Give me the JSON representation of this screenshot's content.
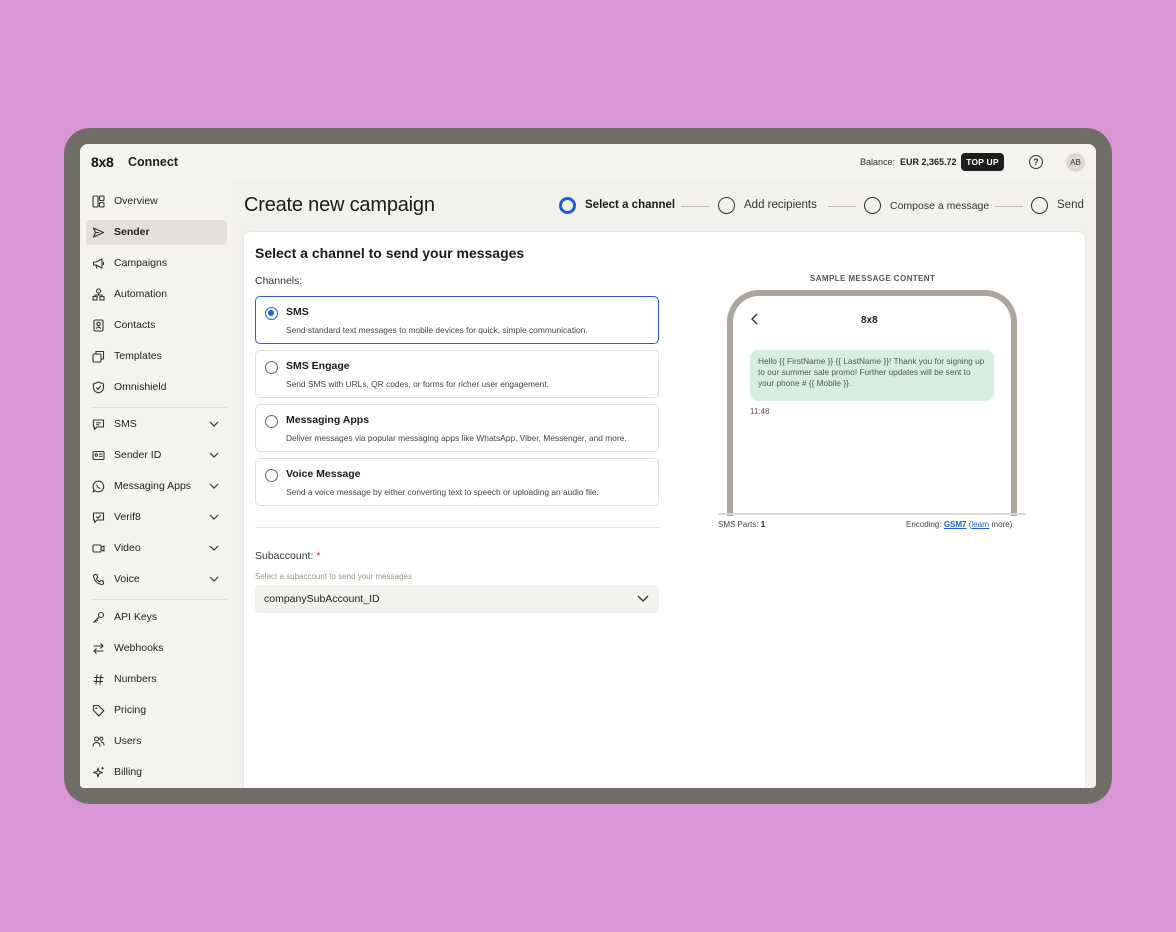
{
  "app": {
    "logo": "8x8",
    "name": "Connect",
    "balance_label": "Balance:",
    "balance_value": "EUR 2,365.72",
    "topup_label": "TOP UP",
    "help_icon": "?",
    "avatar_initials": "AB"
  },
  "sidebar": {
    "items": [
      {
        "label": "Overview",
        "icon": "overview-icon"
      },
      {
        "label": "Sender",
        "icon": "send-icon"
      },
      {
        "label": "Campaigns",
        "icon": "megaphone-icon"
      },
      {
        "label": "Automation",
        "icon": "automation-icon"
      },
      {
        "label": "Contacts",
        "icon": "contacts-icon"
      },
      {
        "label": "Templates",
        "icon": "templates-icon"
      },
      {
        "label": "Omnishield",
        "icon": "shield-icon"
      },
      {
        "label": "SMS",
        "icon": "sms-icon"
      },
      {
        "label": "Sender ID",
        "icon": "id-card-icon"
      },
      {
        "label": "Messaging Apps",
        "icon": "whatsapp-icon"
      },
      {
        "label": "Verif8",
        "icon": "verify-icon"
      },
      {
        "label": "Video",
        "icon": "video-icon"
      },
      {
        "label": "Voice",
        "icon": "phone-icon"
      },
      {
        "label": "API Keys",
        "icon": "key-icon"
      },
      {
        "label": "Webhooks",
        "icon": "arrows-icon"
      },
      {
        "label": "Numbers",
        "icon": "hash-icon"
      },
      {
        "label": "Pricing",
        "icon": "tag-icon"
      },
      {
        "label": "Users",
        "icon": "users-icon"
      },
      {
        "label": "Billing",
        "icon": "sparkle-icon"
      }
    ],
    "active": "Sender"
  },
  "page": {
    "title": "Create new campaign",
    "steps": [
      "Select a channel",
      "Add recipients",
      "Compose a message",
      "Send"
    ],
    "active_step": "Select a channel"
  },
  "card": {
    "title": "Select a channel to send your messages",
    "channels_label": "Channels:",
    "options": [
      {
        "title": "SMS",
        "desc": "Send standard text messages to mobile devices for quick, simple communication.",
        "selected": true
      },
      {
        "title": "SMS Engage",
        "desc": "Send SMS with URLs, QR codes, or forms for richer user engagement.",
        "selected": false
      },
      {
        "title": "Messaging Apps",
        "desc": "Deliver messages via popular messaging apps like WhatsApp, Viber, Messenger, and more.",
        "selected": false
      },
      {
        "title": "Voice Message",
        "desc": "Send a voice message by either converting text to speech or uploading an audio file.",
        "selected": false
      }
    ],
    "subaccount_label": "Subaccount:",
    "required_mark": "*",
    "subaccount_help": "Select a subaccount to send your messages",
    "subaccount_value": "companySubAccount_ID"
  },
  "preview": {
    "label": "SAMPLE MESSAGE CONTENT",
    "phone_title": "8x8",
    "message": "Hello {{ FirstName }} {{ LastName }}! Thank you for signing up to our summer sale promo! Further updates will be sent to your phone # {{ Mobile }}.",
    "time": "11:48",
    "parts_label": "SMS Parts:",
    "parts_value": "1",
    "encoding_label": "Encoding:",
    "encoding_value": "GSM7",
    "learn_prefix": "(",
    "learn_link": "learn",
    "learn_suffix": " more)"
  },
  "colors": {
    "background": "#d896d6",
    "accent": "#1f5ed6",
    "bubble": "#d5eedf"
  }
}
